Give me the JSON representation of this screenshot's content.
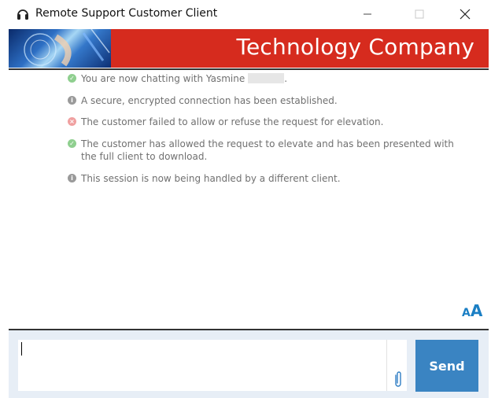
{
  "window": {
    "title": "Remote Support Customer Client",
    "app_icon": "headset-icon",
    "controls": [
      "minimize-icon",
      "maximize-icon",
      "close-icon"
    ]
  },
  "banner": {
    "title": "Technology Company",
    "background_color": "#d62b1e"
  },
  "messages": [
    {
      "icon": "check-circle-icon",
      "status": "success",
      "text": "You are now chatting with Yasmine",
      "suffix": "."
    },
    {
      "icon": "info-circle-icon",
      "status": "info",
      "text": "A secure, encrypted connection has been established."
    },
    {
      "icon": "error-circle-icon",
      "status": "error",
      "text": "The customer failed to allow or refuse the request for elevation."
    },
    {
      "icon": "check-circle-icon",
      "status": "success",
      "text": "The customer has allowed the request to elevate and has been presented with the full client to download."
    },
    {
      "icon": "info-circle-icon",
      "status": "info",
      "text": "This session is now being handled by a different client."
    }
  ],
  "font_size_control": {
    "small": "A",
    "large": "A"
  },
  "composer": {
    "input_value": "",
    "attach_icon": "paperclip-icon",
    "send_label": "Send",
    "send_color": "#3a84c2"
  }
}
